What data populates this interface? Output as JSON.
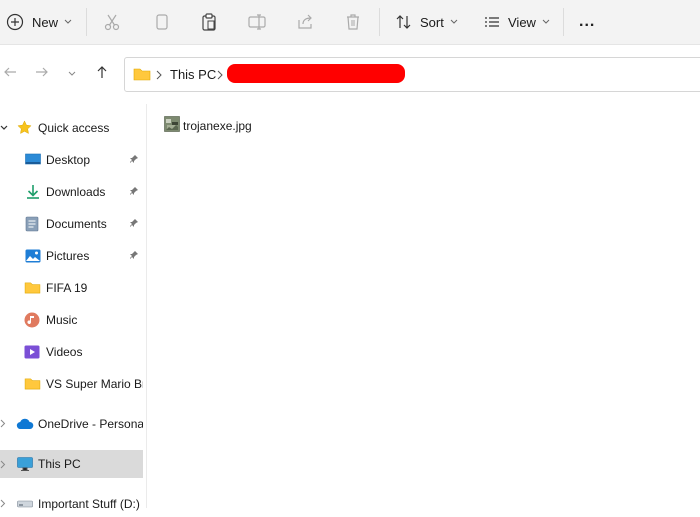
{
  "toolbar": {
    "new_label": "New",
    "sort_label": "Sort",
    "view_label": "View",
    "more_label": "..."
  },
  "address": {
    "crumbs": [
      "This PC"
    ]
  },
  "sidebar": {
    "items": [
      {
        "label": "Quick access"
      },
      {
        "label": "Desktop"
      },
      {
        "label": "Downloads"
      },
      {
        "label": "Documents"
      },
      {
        "label": "Pictures"
      },
      {
        "label": "FIFA 19"
      },
      {
        "label": "Music"
      },
      {
        "label": "Videos"
      },
      {
        "label": "VS Super Mario Bros"
      },
      {
        "label": "OneDrive - Personal"
      },
      {
        "label": "This PC"
      },
      {
        "label": "Important Stuff (D:)"
      }
    ]
  },
  "files": [
    {
      "name": "trojanexe.jpg"
    }
  ],
  "colors": {
    "accent": "#0067c0",
    "folder": "#ffc83d",
    "selected": "#dadada",
    "redaction": "#ff0000"
  }
}
